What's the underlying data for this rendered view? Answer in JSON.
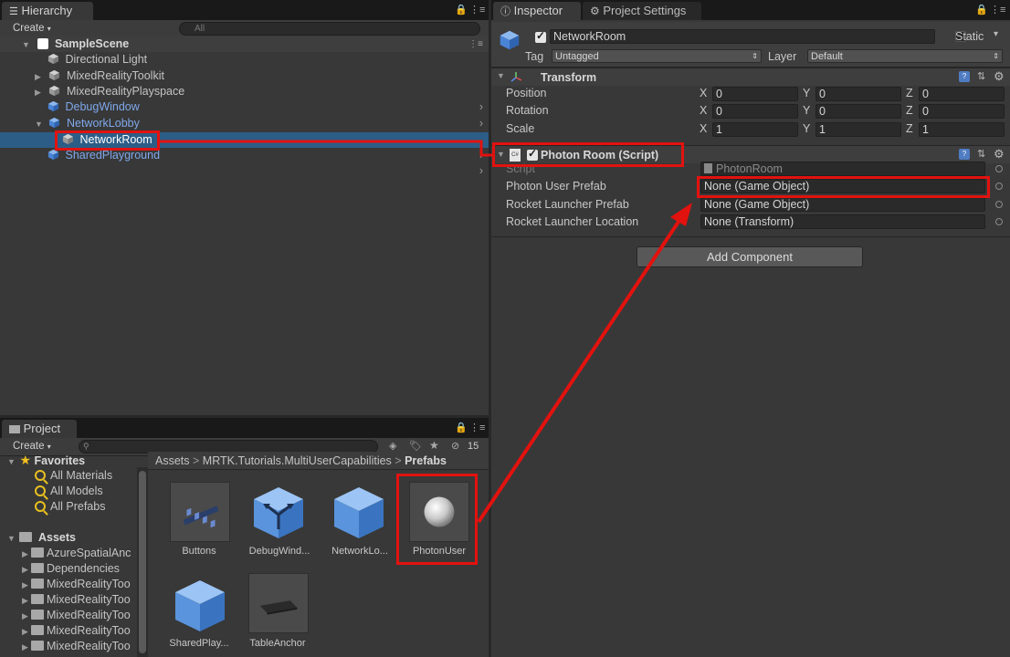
{
  "hierarchy": {
    "tab_label": "Hierarchy",
    "create_label": "Create",
    "search_placeholder": "All",
    "scene_name": "SampleScene",
    "items": [
      {
        "label": "Directional Light"
      },
      {
        "label": "MixedRealityToolkit"
      },
      {
        "label": "MixedRealityPlayspace"
      },
      {
        "label": "DebugWindow"
      },
      {
        "label": "NetworkLobby"
      },
      {
        "label": "NetworkRoom"
      },
      {
        "label": "SharedPlayground"
      }
    ]
  },
  "inspector": {
    "tab_label": "Inspector",
    "project_settings_label": "Project Settings",
    "object_name": "NetworkRoom",
    "static_label": "Static",
    "tag_label": "Tag",
    "tag_value": "Untagged",
    "layer_label": "Layer",
    "layer_value": "Default",
    "transform": {
      "title": "Transform",
      "position_label": "Position",
      "rotation_label": "Rotation",
      "scale_label": "Scale",
      "x": "X",
      "y": "Y",
      "z": "Z",
      "position": [
        "0",
        "0",
        "0"
      ],
      "rotation": [
        "0",
        "0",
        "0"
      ],
      "scale": [
        "1",
        "1",
        "1"
      ]
    },
    "photon_room": {
      "title": "Photon Room (Script)",
      "script_label": "Script",
      "script_value": "PhotonRoom",
      "photon_user_prefab_label": "Photon User Prefab",
      "photon_user_prefab_value": "None (Game Object)",
      "rocket_launcher_prefab_label": "Rocket Launcher Prefab",
      "rocket_launcher_prefab_value": "None (Game Object)",
      "rocket_launcher_location_label": "Rocket Launcher Location",
      "rocket_launcher_location_value": "None (Transform)"
    },
    "add_component_label": "Add Component"
  },
  "project": {
    "tab_label": "Project",
    "create_label": "Create",
    "hidden_count": "15",
    "favorites_label": "Favorites",
    "favorites": [
      "All Materials",
      "All Models",
      "All Prefabs"
    ],
    "assets_label": "Assets",
    "asset_folders": [
      "AzureSpatialAnc",
      "Dependencies",
      "MixedRealityToo",
      "MixedRealityToo",
      "MixedRealityToo",
      "MixedRealityToo",
      "MixedRealityToo"
    ],
    "breadcrumb": [
      "Assets",
      "MRTK.Tutorials.MultiUserCapabilities",
      "Prefabs"
    ],
    "breadcrumb_sep": ">",
    "assets": [
      {
        "label": "Buttons"
      },
      {
        "label": "DebugWind..."
      },
      {
        "label": "NetworkLo..."
      },
      {
        "label": "PhotonUser"
      },
      {
        "label": "SharedPlay..."
      },
      {
        "label": "TableAnchor"
      }
    ]
  },
  "colors": {
    "highlight": "#e2120f",
    "selection": "#2c5d87",
    "prefab_blue": "#7fa8ea"
  }
}
